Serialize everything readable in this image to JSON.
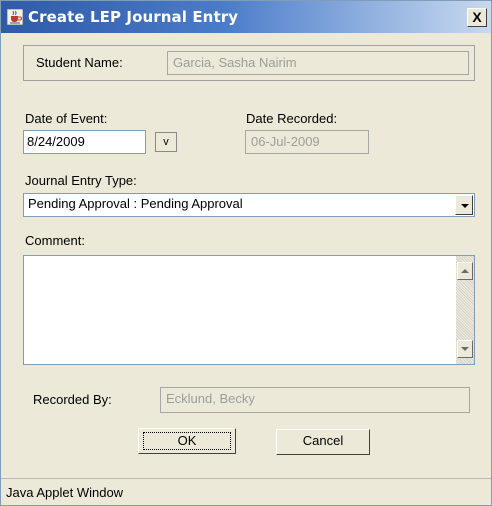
{
  "window": {
    "title": "Create LEP Journal Entry",
    "close_glyph": "X",
    "icon": "java-cup-icon"
  },
  "student": {
    "label": "Student Name:",
    "value": "Garcia, Sasha Nairim"
  },
  "date_of_event": {
    "label": "Date of Event:",
    "value": "8/24/2009",
    "button_label": "v"
  },
  "date_recorded": {
    "label": "Date Recorded:",
    "value": "06-Jul-2009"
  },
  "entry_type": {
    "label": "Journal Entry Type:",
    "selected": "Pending Approval : Pending Approval"
  },
  "comment": {
    "label": "Comment:",
    "value": ""
  },
  "recorded_by": {
    "label": "Recorded By:",
    "value": "Ecklund, Becky"
  },
  "buttons": {
    "ok": "OK",
    "cancel": "Cancel"
  },
  "status": {
    "text": "Java Applet Window"
  },
  "colors": {
    "titlebar_start": "#2f5aa8",
    "titlebar_end": "#c9d9ef",
    "dialog_bg": "#ece9d8",
    "disabled_text": "#9c9c9c"
  }
}
